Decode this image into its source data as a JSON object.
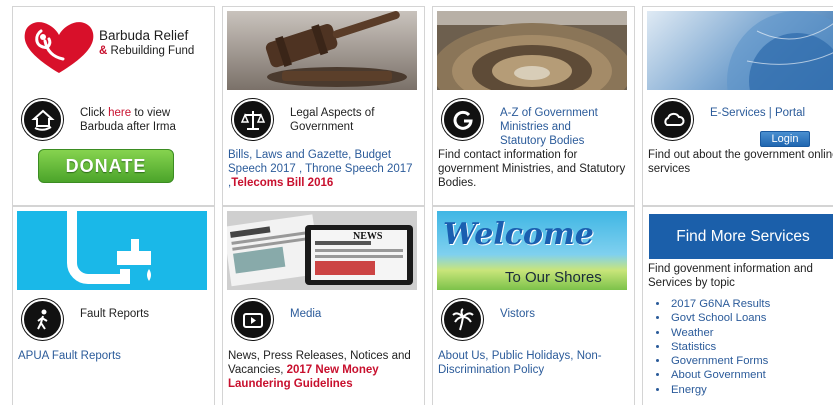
{
  "row1": {
    "barbuda": {
      "logo_line1": "Barbuda Relief",
      "logo_line2_amp": "&",
      "logo_line2": "Rebuilding Fund",
      "click_prefix": "Click",
      "click_here": "here",
      "click_suffix": "to view",
      "click_line2": "Barbuda after Irma",
      "donate": "DONATE"
    },
    "legal": {
      "title_line1": "Legal Aspects of",
      "title_line2": "Government",
      "desc": "Bills, Laws and Gazette, Budget Speech 2017 , Throne Speech 2017 ,",
      "desc_red": "Telecoms Bill 2016"
    },
    "az": {
      "title_line1": "A-Z of Government",
      "title_line2": "Ministries and",
      "title_line3": "Statutory Bodies",
      "desc": "Find contact information for government Ministries, and Statutory Bodies."
    },
    "eservices": {
      "title": "E-Services | Portal",
      "login": "Login",
      "desc": "Find out about the government online services"
    }
  },
  "row2": {
    "fault": {
      "title": "Fault Reports",
      "desc": "APUA Fault Reports"
    },
    "media": {
      "title": "Media",
      "banner_text": "NEWS",
      "desc": "News, Press Releases, Notices and Vacancies,",
      "desc_red": "2017 New Money Laundering Guidelines"
    },
    "visitors": {
      "banner_welcome": "Welcome",
      "banner_sub": "To Our Shores",
      "title": "Vistors",
      "desc": "About Us, Public Holidays, Non-Discrimination Policy"
    },
    "more": {
      "banner": "Find More Services",
      "desc": "Find govenment information and Services by topic",
      "topics": [
        "2017 G6NA Results",
        "Govt School Loans",
        "Weather",
        "Statistics",
        "Government Forms",
        "About Government",
        "Energy"
      ]
    }
  },
  "colors": {
    "blue_text": "#2b5b9a",
    "red": "#c8102e",
    "donate_green": "#5bb335",
    "banner_blue": "#1b5faa",
    "cyan": "#1ab8e8"
  }
}
